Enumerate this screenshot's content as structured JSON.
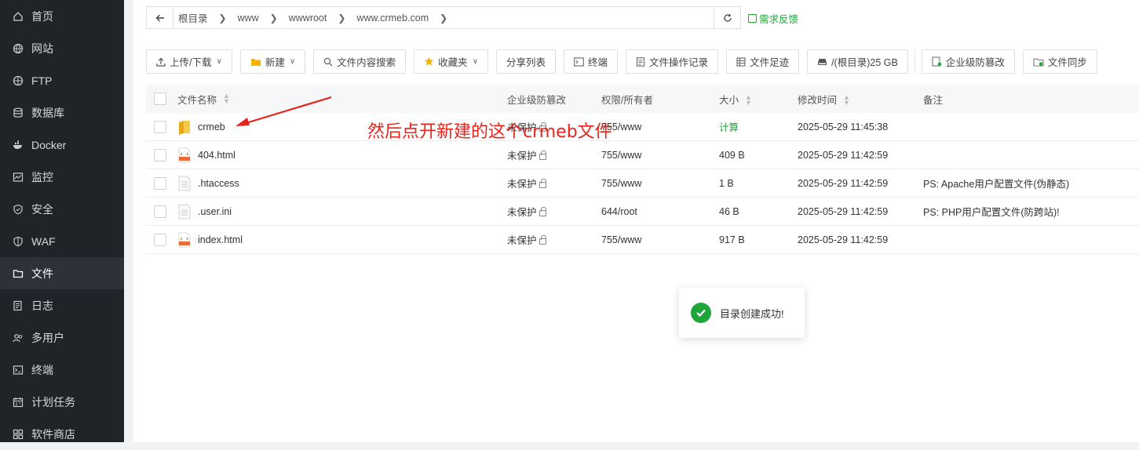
{
  "sidebar": {
    "items": [
      {
        "label": "首页",
        "icon": "home-icon"
      },
      {
        "label": "网站",
        "icon": "globe-icon"
      },
      {
        "label": "FTP",
        "icon": "ftp-globe-icon"
      },
      {
        "label": "数据库",
        "icon": "database-icon"
      },
      {
        "label": "Docker",
        "icon": "docker-icon"
      },
      {
        "label": "监控",
        "icon": "monitor-icon"
      },
      {
        "label": "安全",
        "icon": "shield-icon"
      },
      {
        "label": "WAF",
        "icon": "waf-shield-icon"
      },
      {
        "label": "文件",
        "icon": "folder-icon",
        "active": true
      },
      {
        "label": "日志",
        "icon": "log-icon"
      },
      {
        "label": "多用户",
        "icon": "users-icon"
      },
      {
        "label": "终端",
        "icon": "terminal-icon"
      },
      {
        "label": "计划任务",
        "icon": "schedule-icon"
      },
      {
        "label": "软件商店",
        "icon": "store-icon"
      }
    ]
  },
  "pathbar": {
    "crumbs": [
      "根目录",
      "www",
      "wwwroot",
      "www.crmeb.com"
    ]
  },
  "feedback_label": "需求反馈",
  "toolbar": {
    "upload": "上传/下载",
    "new": "新建",
    "search": "文件内容搜索",
    "favorites": "收藏夹",
    "share_list": "分享列表",
    "terminal": "终端",
    "op_log": "文件操作记录",
    "footprint": "文件足迹",
    "disk": "/(根目录)25 GB",
    "tamper": "企业级防篡改",
    "sync": "文件同步"
  },
  "table": {
    "headers": {
      "name": "文件名称",
      "protect": "企业级防篡改",
      "perm": "权限/所有者",
      "size": "大小",
      "time": "修改时间",
      "note": "备注"
    },
    "rows": [
      {
        "name": "crmeb",
        "type": "folder",
        "protect": "未保护",
        "perm": "755/www",
        "size": "计算",
        "time": "2025-05-29 11:45:38",
        "note": ""
      },
      {
        "name": "404.html",
        "type": "html",
        "protect": "未保护",
        "perm": "755/www",
        "size": "409 B",
        "time": "2025-05-29 11:42:59",
        "note": ""
      },
      {
        "name": ".htaccess",
        "type": "file",
        "protect": "未保护",
        "perm": "755/www",
        "size": "1 B",
        "time": "2025-05-29 11:42:59",
        "note": "PS: Apache用户配置文件(伪静态)"
      },
      {
        "name": ".user.ini",
        "type": "file",
        "protect": "未保护",
        "perm": "644/root",
        "size": "46 B",
        "time": "2025-05-29 11:42:59",
        "note": "PS: PHP用户配置文件(防跨站)!"
      },
      {
        "name": "index.html",
        "type": "html",
        "protect": "未保护",
        "perm": "755/www",
        "size": "917 B",
        "time": "2025-05-29 11:42:59",
        "note": ""
      }
    ]
  },
  "annotation": "然后点开新建的这个crmeb文件",
  "toast": "目录创建成功!",
  "colors": {
    "accent": "#20a53a",
    "annotation": "#e8231c",
    "sidebar": "#1f2428"
  }
}
